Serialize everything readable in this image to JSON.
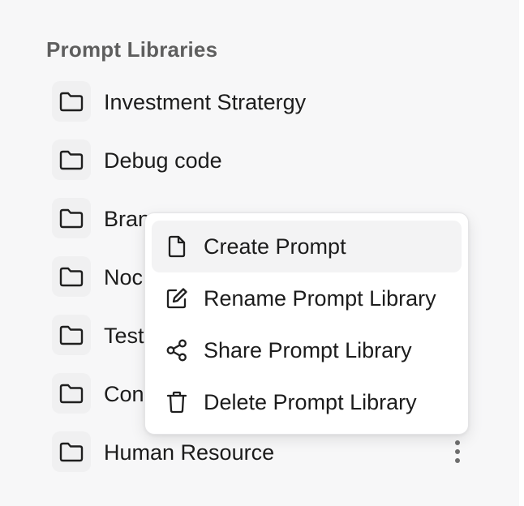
{
  "sidebar": {
    "section_title": "Prompt Libraries",
    "libraries": [
      {
        "label": "Investment Stratergy",
        "icon": "folder-icon"
      },
      {
        "label": "Debug code",
        "icon": "folder-icon"
      },
      {
        "label": "Bran",
        "icon": "folder-icon"
      },
      {
        "label": "Noc",
        "icon": "folder-icon"
      },
      {
        "label": "Test",
        "icon": "folder-icon"
      },
      {
        "label": "Con",
        "icon": "folder-icon"
      },
      {
        "label": "Human Resource",
        "icon": "folder-icon",
        "has_more_menu": true,
        "more_icon": "vertical-ellipsis-icon"
      }
    ]
  },
  "context_menu": {
    "items": [
      {
        "label": "Create Prompt",
        "icon": "file-icon",
        "highlighted": true
      },
      {
        "label": "Rename Prompt Library",
        "icon": "edit-icon"
      },
      {
        "label": "Share Prompt Library",
        "icon": "share-icon"
      },
      {
        "label": "Delete Prompt Library",
        "icon": "trash-icon"
      }
    ]
  },
  "colors": {
    "background": "#f7f7f8",
    "text": "#1c1c1c",
    "section_title": "#5e5e5e",
    "menu_highlight": "#f3f3f4",
    "menu_background": "#ffffff"
  }
}
